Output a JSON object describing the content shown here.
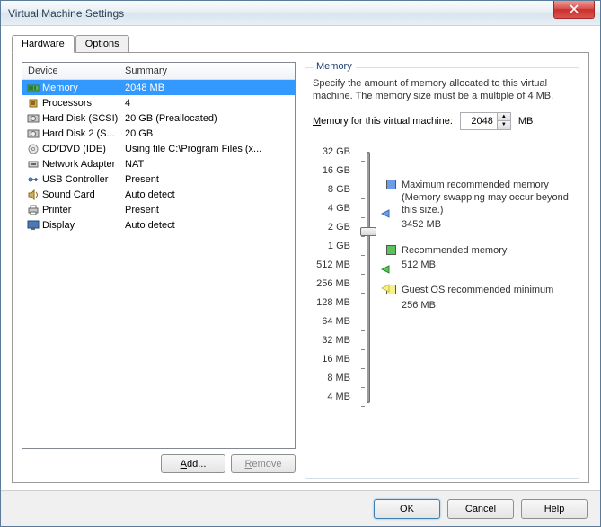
{
  "window_title": "Virtual Machine Settings",
  "tabs": {
    "hardware": "Hardware",
    "options": "Options"
  },
  "list_headers": {
    "device": "Device",
    "summary": "Summary"
  },
  "devices": [
    {
      "icon": "memory",
      "name": "Memory",
      "summary": "2048 MB",
      "selected": true
    },
    {
      "icon": "cpu",
      "name": "Processors",
      "summary": "4"
    },
    {
      "icon": "hdd",
      "name": "Hard Disk (SCSI)",
      "summary": "20 GB (Preallocated)"
    },
    {
      "icon": "hdd",
      "name": "Hard Disk 2 (S...",
      "summary": "20 GB"
    },
    {
      "icon": "cd",
      "name": "CD/DVD (IDE)",
      "summary": "Using file C:\\Program Files (x..."
    },
    {
      "icon": "net",
      "name": "Network Adapter",
      "summary": "NAT"
    },
    {
      "icon": "usb",
      "name": "USB Controller",
      "summary": "Present"
    },
    {
      "icon": "sound",
      "name": "Sound Card",
      "summary": "Auto detect"
    },
    {
      "icon": "printer",
      "name": "Printer",
      "summary": "Present"
    },
    {
      "icon": "display",
      "name": "Display",
      "summary": "Auto detect"
    }
  ],
  "buttons": {
    "add": "Add...",
    "remove": "Remove",
    "ok": "OK",
    "cancel": "Cancel",
    "help": "Help"
  },
  "memory": {
    "group_label": "Memory",
    "desc": "Specify the amount of memory allocated to this virtual machine. The memory size must be a multiple of 4 MB.",
    "input_label_pre": "Memory for this virtual machine:",
    "value": "2048",
    "unit": "MB",
    "scale": [
      "32 GB",
      "16 GB",
      "8 GB",
      "4 GB",
      "2 GB",
      "1 GB",
      "512 MB",
      "256 MB",
      "128 MB",
      "64 MB",
      "32 MB",
      "16 MB",
      "8 MB",
      "4 MB"
    ],
    "legend": {
      "max": {
        "label": "Maximum recommended memory",
        "sub": "(Memory swapping may occur beyond this size.)",
        "val": "3452 MB",
        "color": "#6d9de8"
      },
      "rec": {
        "label": "Recommended memory",
        "val": "512 MB",
        "color": "#5cc25c"
      },
      "min": {
        "label": "Guest OS recommended minimum",
        "val": "256 MB",
        "color": "#f5f08a"
      }
    }
  }
}
